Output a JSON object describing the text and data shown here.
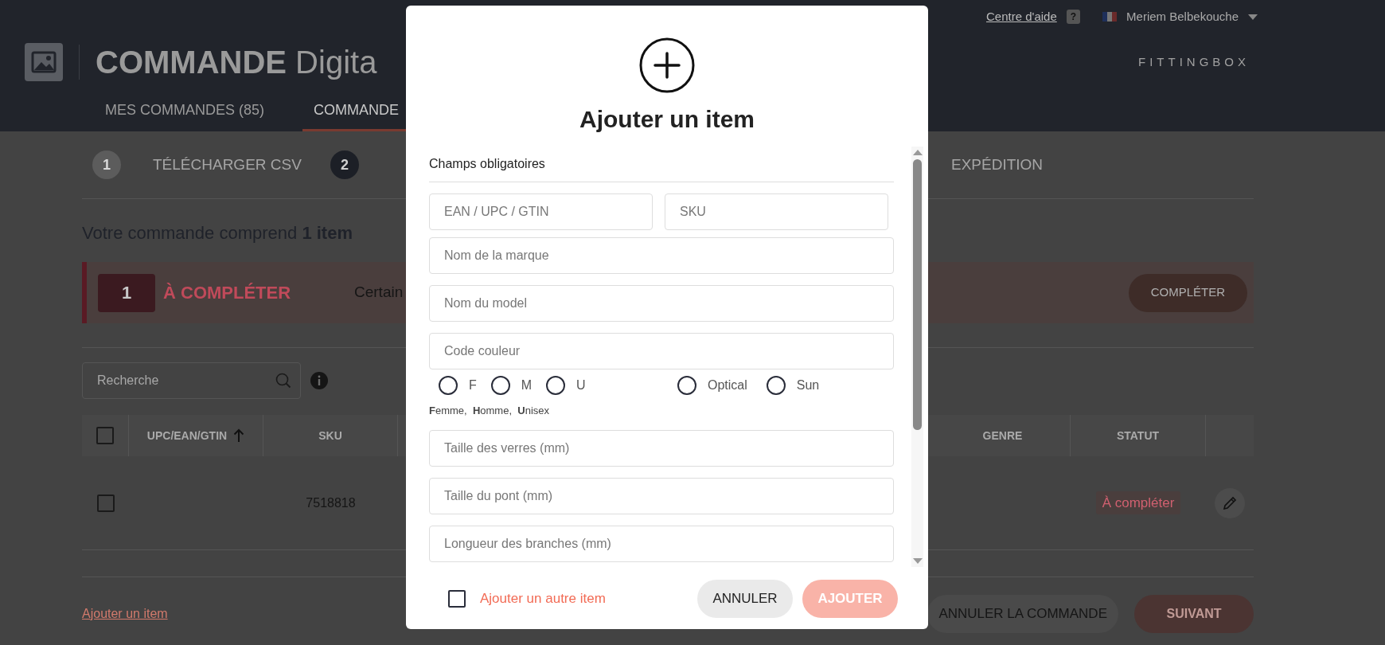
{
  "header": {
    "title": "COMMANDE",
    "title_light": "Digita",
    "help_link": "Centre d'aide",
    "help_badge": "?",
    "user": "Meriem Belbekouche",
    "brand": "FITTINGBOX"
  },
  "nav_tabs": [
    {
      "label": "MES COMMANDES (85)",
      "selected": false
    },
    {
      "label": "COMMANDE",
      "selected": true
    }
  ],
  "steps": [
    {
      "number": "1",
      "label": "TÉLÉCHARGER CSV",
      "selected": false
    },
    {
      "number": "2",
      "selected": true
    },
    {
      "label": "EXPÉDITION",
      "selected": false
    }
  ],
  "summary": "Votre commande comprend **1 item**",
  "alert": {
    "count": "1",
    "title": "À COMPLÉTER",
    "message": "Certain",
    "button": "COMPLÉTER"
  },
  "search": {
    "placeholder": "Recherche"
  },
  "table": {
    "select_all_checked": false,
    "columns": [
      {
        "label": "UPC/EAN/GTIN",
        "sorted": true
      },
      {
        "label": "SKU",
        "sorted": false
      },
      {
        "label": "GENRE",
        "sorted": false
      },
      {
        "label": "STATUT",
        "sorted": false
      }
    ],
    "rows": [
      {
        "checked": false,
        "sku": "7518818",
        "status": "À compléter"
      }
    ]
  },
  "footer": {
    "add_link": "Ajouter un item",
    "cancel": "ANNULER LA COMMANDE",
    "next": "SUIVANT"
  },
  "modal": {
    "title": "Ajouter un item",
    "section": "Champs obligatoires",
    "id_fields": [
      {
        "placeholder": "EAN / UPC / GTIN"
      },
      {
        "placeholder": "SKU"
      }
    ],
    "fields": [
      {
        "placeholder": "Nom de la marque"
      },
      {
        "placeholder": "Nom du model"
      },
      {
        "placeholder": "Code couleur"
      }
    ],
    "gender": [
      {
        "label": "F",
        "selected": false
      },
      {
        "label": "M",
        "selected": false
      },
      {
        "label": "U",
        "selected": false
      }
    ],
    "type": [
      {
        "label": "Optical",
        "selected": false
      },
      {
        "label": "Sun",
        "selected": false
      }
    ],
    "legend": "**F**emme,  **H**omme,  **U**nisex",
    "size_fields": [
      {
        "placeholder": "Taille des verres (mm)"
      },
      {
        "placeholder": "Taille du pont (mm)"
      },
      {
        "placeholder": "Longueur des branches (mm)"
      }
    ],
    "another": {
      "label": "Ajouter un autre item",
      "checked": false
    },
    "cancel": "ANNULER",
    "submit": "AJOUTER"
  }
}
